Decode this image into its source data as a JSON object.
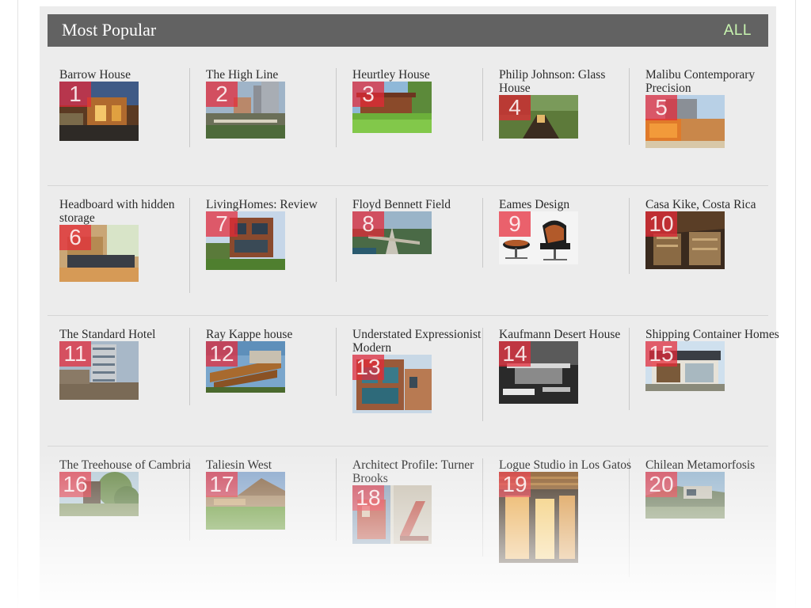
{
  "header": {
    "title": "Most Popular",
    "all_label": "ALL"
  },
  "items": [
    {
      "rank": "1",
      "title": "Barrow House"
    },
    {
      "rank": "2",
      "title": "The High Line"
    },
    {
      "rank": "3",
      "title": "Heurtley House"
    },
    {
      "rank": "4",
      "title": "Philip Johnson: Glass House"
    },
    {
      "rank": "5",
      "title": "Malibu Contemporary Precision"
    },
    {
      "rank": "6",
      "title": "Headboard with hidden storage"
    },
    {
      "rank": "7",
      "title": "LivingHomes: Review"
    },
    {
      "rank": "8",
      "title": "Floyd Bennett Field"
    },
    {
      "rank": "9",
      "title": "Eames Design"
    },
    {
      "rank": "10",
      "title": "Casa Kike, Costa Rica"
    },
    {
      "rank": "11",
      "title": "The Standard Hotel"
    },
    {
      "rank": "12",
      "title": "Ray Kappe house"
    },
    {
      "rank": "13",
      "title": "Understated Expressionist Modern"
    },
    {
      "rank": "14",
      "title": "Kaufmann Desert House"
    },
    {
      "rank": "15",
      "title": "Shipping Container Homes"
    },
    {
      "rank": "16",
      "title": "The Treehouse of Cambria"
    },
    {
      "rank": "17",
      "title": "Taliesin West"
    },
    {
      "rank": "18",
      "title": "Architect Profile: Turner Brooks"
    },
    {
      "rank": "19",
      "title": "Logue Studio in Los Gatos"
    },
    {
      "rank": "20",
      "title": "Chilean Metamorfosis"
    }
  ],
  "colors": {
    "header_bg": "#626262",
    "panel_bg": "#ececec",
    "all_link": "#c8f5b0",
    "rank_badge": "#e62837"
  }
}
